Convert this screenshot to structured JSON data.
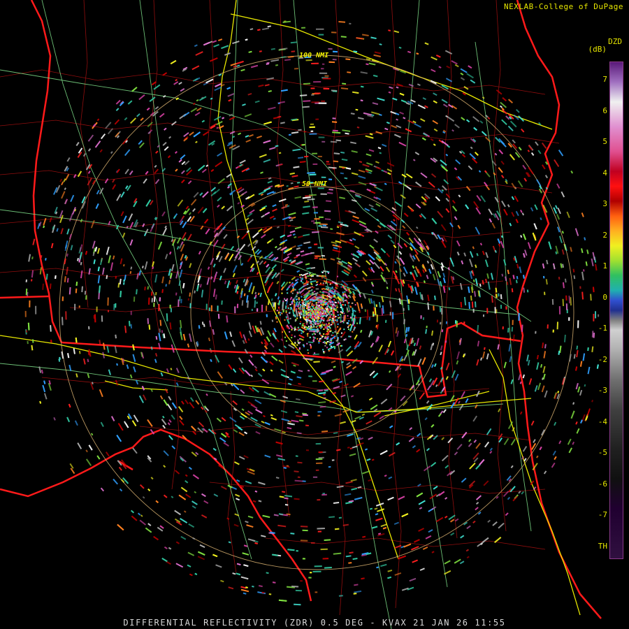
{
  "header": {
    "credit": "NEXLAB-College of DuPage",
    "product_code": "DZD",
    "units": "(dB)"
  },
  "footer": {
    "title": "DIFFERENTIAL REFLECTIVITY (ZDR) 0.5 DEG - KVAX 21 JAN 26 11:55"
  },
  "map": {
    "range_rings": [
      {
        "label": "50 NMI"
      },
      {
        "label": "100 NMI"
      }
    ],
    "colors": {
      "state_border": "#ff1a1a",
      "county_border": "#a01010",
      "interstate": "#e8e800",
      "highway": "#7fe08a",
      "range_ring": "#d8b070"
    }
  },
  "legend": {
    "ticks": [
      "7",
      "6",
      "5",
      "4",
      "3",
      "2",
      "1",
      "0",
      "-1",
      "-2",
      "-3",
      "-4",
      "-5",
      "-6",
      "-7",
      "TH"
    ]
  }
}
